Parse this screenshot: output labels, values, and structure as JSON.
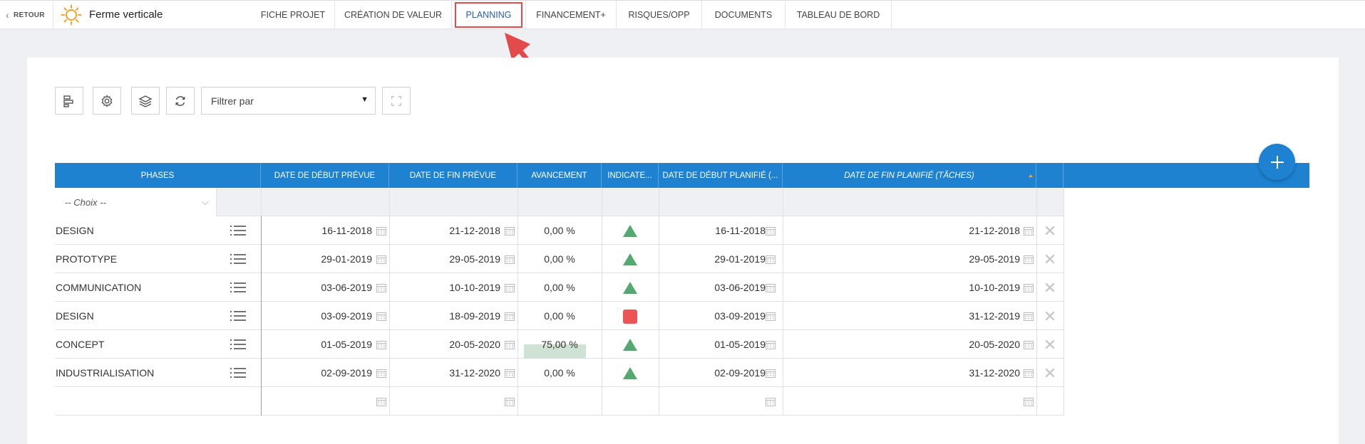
{
  "back": {
    "label": "RETOUR"
  },
  "project": {
    "title": "Ferme verticale"
  },
  "tabs": [
    {
      "label": "FICHE PROJET"
    },
    {
      "label": "CRÉATION DE VALEUR"
    },
    {
      "label": "PLANNING"
    },
    {
      "label": "FINANCEMENT+"
    },
    {
      "label": "RISQUES/OPP"
    },
    {
      "label": "DOCUMENTS"
    },
    {
      "label": "TABLEAU DE BORD"
    }
  ],
  "active_tab": "PLANNING",
  "toolbar": {
    "filter_label": "Filtrer par",
    "buttons": [
      "gantt-icon",
      "gear-icon",
      "layers-icon",
      "refresh-icon",
      "fullscreen-icon"
    ]
  },
  "table": {
    "columns": [
      "PHASES",
      "DATE DE DÉBUT PRÉVUE",
      "DATE DE FIN PRÉVUE",
      "AVANCEMENT",
      "INDICATE...",
      "DATE DE DÉBUT PLANIFIÉ (...",
      "DATE DE FIN PLANIFIÉ (TÂCHES)"
    ],
    "choice_placeholder": "-- Choix --",
    "rows": [
      {
        "phase": "DESIGN",
        "start": "16-11-2018",
        "end": "21-12-2018",
        "progress": "0,00 %",
        "progress_value": 0,
        "indicator": "green-triangle",
        "planned_start": "16-11-2018",
        "planned_end": "21-12-2018"
      },
      {
        "phase": "PROTOTYPE",
        "start": "29-01-2019",
        "end": "29-05-2019",
        "progress": "0,00 %",
        "progress_value": 0,
        "indicator": "green-triangle",
        "planned_start": "29-01-2019",
        "planned_end": "29-05-2019"
      },
      {
        "phase": "COMMUNICATION",
        "start": "03-06-2019",
        "end": "10-10-2019",
        "progress": "0,00 %",
        "progress_value": 0,
        "indicator": "green-triangle",
        "planned_start": "03-06-2019",
        "planned_end": "10-10-2019"
      },
      {
        "phase": "DESIGN",
        "start": "03-09-2019",
        "end": "18-09-2019",
        "progress": "0,00 %",
        "progress_value": 0,
        "indicator": "red-square",
        "planned_start": "03-09-2019",
        "planned_end": "31-12-2019"
      },
      {
        "phase": "CONCEPT",
        "start": "01-05-2019",
        "end": "20-05-2020",
        "progress": "75,00 %",
        "progress_value": 75,
        "indicator": "green-triangle",
        "planned_start": "01-05-2019",
        "planned_end": "20-05-2020"
      },
      {
        "phase": "INDUSTRIALISATION",
        "start": "02-09-2019",
        "end": "31-12-2020",
        "progress": "0,00 %",
        "progress_value": 0,
        "indicator": "green-triangle",
        "planned_start": "02-09-2019",
        "planned_end": "31-12-2020"
      }
    ]
  },
  "colors": {
    "header": "#1e82d0",
    "indicator_ok": "#55a86f",
    "indicator_alert": "#ee5455",
    "progress_fill": "#cfe2d3",
    "highlight": "#e24b4b"
  }
}
